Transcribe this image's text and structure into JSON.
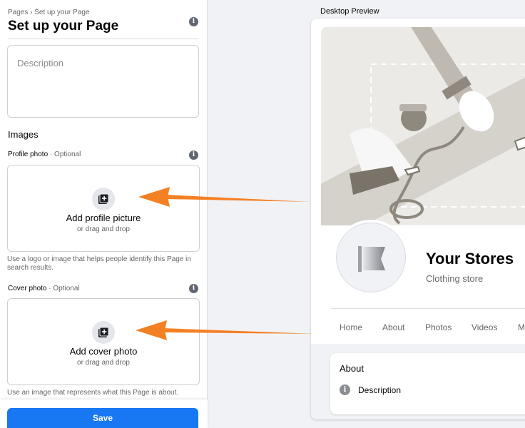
{
  "breadcrumb": "Pages › Set up your Page",
  "title": "Set up your Page",
  "description_placeholder": "Description",
  "images_heading": "Images",
  "profile_photo": {
    "label": "Profile photo",
    "optional": " · Optional",
    "title": "Add profile picture",
    "sub": "or drag and drop",
    "hint": "Use a logo or image that helps people identify this Page in search results."
  },
  "cover_photo": {
    "label": "Cover photo",
    "optional": " · Optional",
    "title": "Add cover photo",
    "sub": "or drag and drop",
    "hint": "Use an image that represents what this Page is about."
  },
  "save_label": "Save",
  "preview": {
    "label": "Desktop Preview",
    "page_name": "Your Stores",
    "category": "Clothing store",
    "tabs": [
      "Home",
      "About",
      "Photos",
      "Videos",
      "M"
    ],
    "about_title": "About",
    "about_description": "Description"
  },
  "colors": {
    "primary": "#1877f2",
    "arrow": "#f48024"
  },
  "icons": [
    "info-icon",
    "add-photo-icon",
    "flag-icon"
  ]
}
